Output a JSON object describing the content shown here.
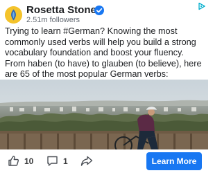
{
  "header": {
    "page_name": "Rosetta Stone",
    "followers": "2.51m followers",
    "avatar_icon": "rosetta-stone-logo-icon",
    "verified_icon": "verified-badge-icon",
    "adchoices_icon": "adchoices-icon"
  },
  "post": {
    "text": "Trying to learn #German? Knowing the most commonly used verbs will help you build a strong vocabulary foundation and boost your fluency. From haben (to have) to glauben (to believe), here are 65 of the most popular German verbs:"
  },
  "footer": {
    "like_count": "10",
    "comment_count": "1",
    "cta_label": "Learn More",
    "like_icon": "thumbs-up-icon",
    "comment_icon": "comment-icon",
    "share_icon": "share-icon"
  },
  "colors": {
    "cta_background": "#1877f2",
    "verified_badge": "#1877f2",
    "avatar_background": "#f4c32b"
  }
}
